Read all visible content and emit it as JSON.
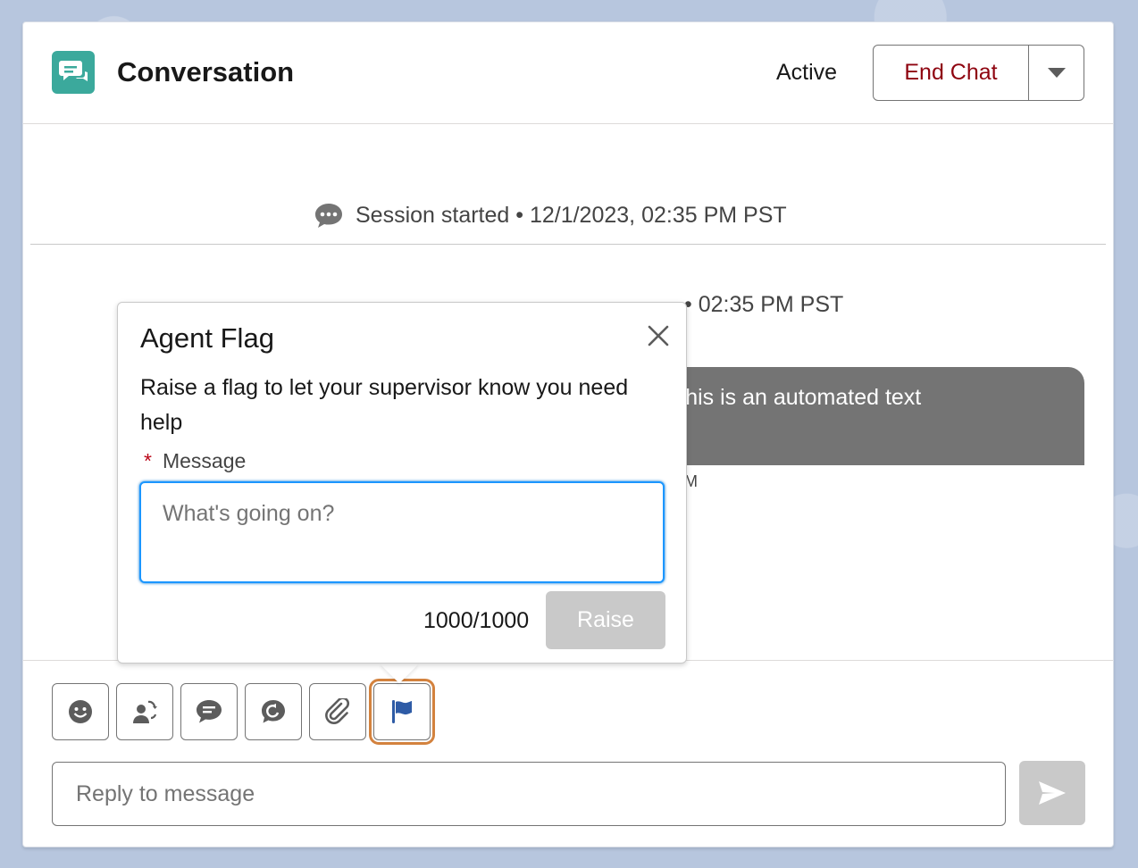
{
  "header": {
    "title": "Conversation",
    "status": "Active",
    "end_chat_label": "End Chat"
  },
  "timeline": {
    "session_started": "Session started • 12/1/2023, 02:35 PM PST",
    "joined_fragment": "• 02:35 PM PST",
    "bubble_fragment": "y! This is an automated text",
    "bubble_meta_fragment": "M"
  },
  "agent_flag": {
    "title": "Agent Flag",
    "description": "Raise a flag to let your supervisor know you need help",
    "required_marker": "*",
    "message_label": "Message",
    "message_placeholder": "What's going on?",
    "char_count": "1000/1000",
    "raise_label": "Raise"
  },
  "composer": {
    "reply_placeholder": "Reply to message",
    "tools": [
      "emoji-icon",
      "transfer-icon",
      "quick-text-icon",
      "consult-icon",
      "attachment-icon",
      "flag-icon"
    ]
  },
  "colors": {
    "brand_teal": "#3ba99c",
    "end_chat_red": "#8e030f",
    "focus_blue": "#1b96ff",
    "highlight_orange": "#d3823e",
    "flag_blue": "#2e5ba6"
  }
}
